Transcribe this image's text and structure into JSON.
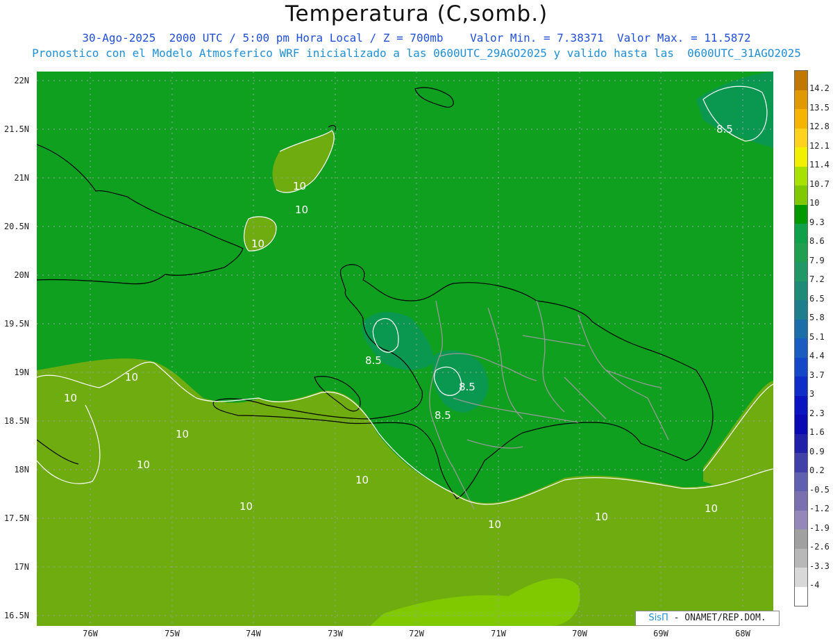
{
  "header": {
    "title": "Temperatura (C,somb.)",
    "line1": "30-Ago-2025  2000 UTC / 5:00 pm Hora Local / Z = 700mb    Valor Min. = 7.38371  Valor Max. = 11.5872",
    "line2": "Pronostico con el Modelo Atmosferico WRF inicializado a las 0600UTC_29AGO2025 y valido hasta las  0600UTC_31AGO2025"
  },
  "axes": {
    "lat_labels": [
      "22N",
      "21.5N",
      "21N",
      "20.5N",
      "20N",
      "19.5N",
      "19N",
      "18.5N",
      "18N",
      "17.5N",
      "17N",
      "16.5N"
    ],
    "lon_labels": [
      "76W",
      "75W",
      "74W",
      "73W",
      "72W",
      "71W",
      "70W",
      "69W",
      "68W"
    ]
  },
  "contour_labels": [
    "10",
    "10",
    "10",
    "10",
    "10",
    "10",
    "10",
    "10",
    "10",
    "10",
    "10",
    "10",
    "8.5",
    "8.5",
    "8.5",
    "8.5"
  ],
  "colorbar": {
    "labels": [
      "14.2",
      "13.5",
      "12.8",
      "12.1",
      "11.4",
      "10.7",
      "10",
      "9.3",
      "8.6",
      "7.9",
      "7.2",
      "6.5",
      "5.8",
      "5.1",
      "4.4",
      "3.7",
      "3",
      "2.3",
      "1.6",
      "0.9",
      "0.2",
      "-0.5",
      "-1.2",
      "-1.9",
      "-2.6",
      "-3.3",
      "-4"
    ],
    "colors": [
      "#c07800",
      "#e09a00",
      "#f5b400",
      "#ffd21e",
      "#f0f000",
      "#a8e000",
      "#80c800",
      "#009a00",
      "#0fa04a",
      "#1ea050",
      "#209868",
      "#208a78",
      "#1f7e8c",
      "#1c6ea8",
      "#1a5cc0",
      "#1448c8",
      "#0f2ec8",
      "#0a14c0",
      "#0a0ab4",
      "#2020a8",
      "#4040a8",
      "#6060b0",
      "#7a70b0",
      "#9488b8",
      "#a0a0a0",
      "#b8b8b8",
      "#d8d8d8",
      "#ffffff"
    ]
  },
  "credit": {
    "brand": "SisΠ",
    "text": " - ONAMET/REP.DOM."
  },
  "map_colors": {
    "base": "#0fa020",
    "warm": "#6eac10",
    "warmer": "#80c800",
    "cool": "#0a9850",
    "contour": "#ffffff",
    "border": "#000000",
    "provinces": "#999999"
  }
}
